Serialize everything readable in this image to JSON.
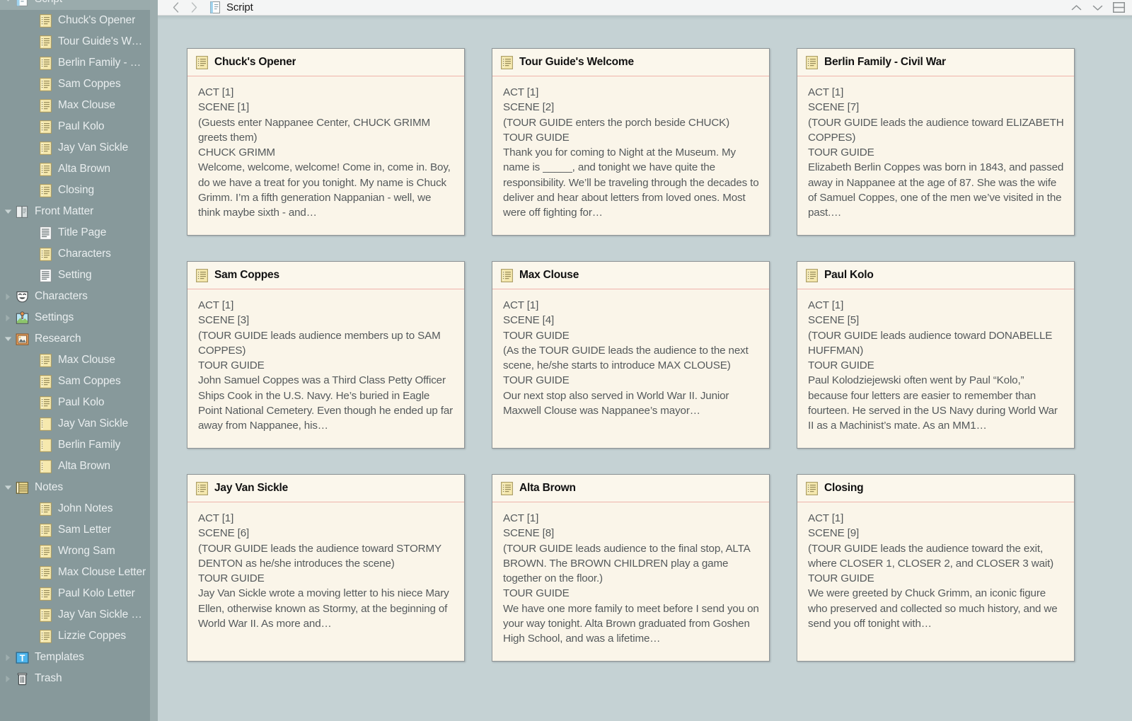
{
  "header": {
    "back_label": "‹",
    "forward_label": "›",
    "doc_icon": "script-document-icon",
    "title": "Script",
    "up_label": "chevron-up-icon",
    "down_label": "chevron-down-icon",
    "split_label": "split-view-icon"
  },
  "binder": {
    "items": [
      {
        "label": "Script",
        "icon": "script-document-icon",
        "level": 0,
        "twisty": "down",
        "selected": true,
        "partial": true
      },
      {
        "label": "Chuck's Opener",
        "icon": "script-page-icon",
        "level": 1,
        "twisty": "none",
        "selected": false
      },
      {
        "label": "Tour Guide's Welc…",
        "icon": "script-page-icon",
        "level": 1,
        "twisty": "none",
        "selected": false
      },
      {
        "label": "Berlin Family - Civ…",
        "icon": "script-page-icon",
        "level": 1,
        "twisty": "none",
        "selected": false
      },
      {
        "label": "Sam Coppes",
        "icon": "script-page-icon",
        "level": 1,
        "twisty": "none",
        "selected": false
      },
      {
        "label": "Max Clouse",
        "icon": "script-page-icon",
        "level": 1,
        "twisty": "none",
        "selected": false
      },
      {
        "label": "Paul Kolo",
        "icon": "script-page-icon",
        "level": 1,
        "twisty": "none",
        "selected": false
      },
      {
        "label": "Jay Van Sickle",
        "icon": "script-page-icon",
        "level": 1,
        "twisty": "none",
        "selected": false
      },
      {
        "label": "Alta Brown",
        "icon": "script-page-icon",
        "level": 1,
        "twisty": "none",
        "selected": false
      },
      {
        "label": "Closing",
        "icon": "script-page-icon",
        "level": 1,
        "twisty": "none",
        "selected": false
      },
      {
        "label": "Front Matter",
        "icon": "front-matter-folder-icon",
        "level": 0,
        "twisty": "down",
        "selected": false
      },
      {
        "label": "Title Page",
        "icon": "text-page-icon",
        "level": 1,
        "twisty": "none",
        "selected": false
      },
      {
        "label": "Characters",
        "icon": "script-page-icon",
        "level": 1,
        "twisty": "none",
        "selected": false
      },
      {
        "label": "Setting",
        "icon": "text-page-icon",
        "level": 1,
        "twisty": "none",
        "selected": false
      },
      {
        "label": "Characters",
        "icon": "theatre-mask-icon",
        "level": 0,
        "twisty": "right",
        "selected": false
      },
      {
        "label": "Settings",
        "icon": "settings-place-icon",
        "level": 0,
        "twisty": "right",
        "selected": false
      },
      {
        "label": "Research",
        "icon": "research-folder-icon",
        "level": 0,
        "twisty": "down",
        "selected": false
      },
      {
        "label": "Max Clouse",
        "icon": "script-page-icon",
        "level": 1,
        "twisty": "none",
        "selected": false
      },
      {
        "label": "Sam Coppes",
        "icon": "script-page-icon",
        "level": 1,
        "twisty": "none",
        "selected": false
      },
      {
        "label": "Paul Kolo",
        "icon": "script-page-icon",
        "level": 1,
        "twisty": "none",
        "selected": false
      },
      {
        "label": "Jay Van Sickle",
        "icon": "blank-page-icon",
        "level": 1,
        "twisty": "none",
        "selected": false
      },
      {
        "label": "Berlin Family",
        "icon": "blank-page-icon",
        "level": 1,
        "twisty": "none",
        "selected": false
      },
      {
        "label": "Alta Brown",
        "icon": "blank-page-icon",
        "level": 1,
        "twisty": "none",
        "selected": false
      },
      {
        "label": "Notes",
        "icon": "notes-folder-icon",
        "level": 0,
        "twisty": "down",
        "selected": false
      },
      {
        "label": "John Notes",
        "icon": "script-page-icon",
        "level": 1,
        "twisty": "none",
        "selected": false
      },
      {
        "label": "Sam Letter",
        "icon": "script-page-icon",
        "level": 1,
        "twisty": "none",
        "selected": false
      },
      {
        "label": "Wrong Sam",
        "icon": "script-page-icon",
        "level": 1,
        "twisty": "none",
        "selected": false
      },
      {
        "label": "Max Clouse Letter",
        "icon": "script-page-icon",
        "level": 1,
        "twisty": "none",
        "selected": false
      },
      {
        "label": "Paul Kolo Letter",
        "icon": "script-page-icon",
        "level": 1,
        "twisty": "none",
        "selected": false
      },
      {
        "label": "Jay Van Sickle Let…",
        "icon": "script-page-icon",
        "level": 1,
        "twisty": "none",
        "selected": false
      },
      {
        "label": "Lizzie Coppes",
        "icon": "script-page-icon",
        "level": 1,
        "twisty": "none",
        "selected": false
      },
      {
        "label": "Templates",
        "icon": "templates-folder-icon",
        "level": 0,
        "twisty": "right",
        "selected": false
      },
      {
        "label": "Trash",
        "icon": "trash-icon",
        "level": 0,
        "twisty": "right",
        "selected": false
      }
    ]
  },
  "corkboard": {
    "cards": [
      {
        "icon": "script-page-icon",
        "title": "Chuck's Opener",
        "synopsis": "ACT [1]\nSCENE [1]\n(Guests enter Nappanee Center, CHUCK GRIMM greets them)\nCHUCK GRIMM\nWelcome, welcome, welcome! Come in, come in. Boy, do we have a treat for you tonight. My name is Chuck Grimm. I’m a fifth generation Nappanian - well, we think maybe sixth - and…"
      },
      {
        "icon": "script-page-icon",
        "title": "Tour Guide's Welcome",
        "synopsis": "ACT [1]\nSCENE [2]\n(TOUR GUIDE enters the porch beside CHUCK)\nTOUR GUIDE\nThank you for coming to Night at the Museum. My name is _____, and tonight we have quite the responsibility. We’ll be traveling through the decades to deliver and hear about letters from loved ones. Most were off fighting for…"
      },
      {
        "icon": "script-page-icon",
        "title": "Berlin Family - Civil War",
        "synopsis": "ACT [1]\nSCENE [7]\n(TOUR GUIDE leads the audience toward ELIZABETH COPPES)\nTOUR GUIDE\nElizabeth Berlin Coppes was born in 1843, and passed away in Nappanee at the age of 87. She was the wife of Samuel Coppes, one of the men we’ve visited in the past.…"
      },
      {
        "icon": "script-page-icon",
        "title": "Sam Coppes",
        "synopsis": "ACT [1]\nSCENE [3]\n(TOUR GUIDE leads audience members up to SAM COPPES)\nTOUR GUIDE\nJohn Samuel Coppes was a Third Class Petty Officer Ships Cook in the U.S. Navy. He’s buried in Eagle Point National Cemetery. Even though he ended up far away from Nappanee, his…"
      },
      {
        "icon": "script-page-icon",
        "title": "Max Clouse",
        "synopsis": "ACT [1]\nSCENE [4]\nTOUR GUIDE\n(As the TOUR GUIDE leads the audience to the next scene, he/she starts to introduce MAX CLOUSE)\nTOUR GUIDE\nOur next stop also served in World War II. Junior Maxwell Clouse was Nappanee’s mayor…"
      },
      {
        "icon": "script-page-icon",
        "title": "Paul Kolo",
        "synopsis": "ACT [1]\nSCENE [5]\n(TOUR GUIDE leads audience toward DONABELLE HUFFMAN)\nTOUR GUIDE\nPaul Kolodziejewski often went by Paul “Kolo,” because four letters are easier to remember than fourteen. He served in the US Navy during World War II as a Machinist’s mate. As an MM1…"
      },
      {
        "icon": "script-page-icon",
        "title": "Jay Van Sickle",
        "synopsis": "ACT [1]\nSCENE [6]\n(TOUR GUIDE leads the audience toward STORMY DENTON as he/she introduces the scene)\nTOUR GUIDE\nJay Van Sickle wrote a moving letter to his niece Mary Ellen, otherwise known as Stormy, at the beginning of World War II. As more and…"
      },
      {
        "icon": "script-page-icon",
        "title": "Alta Brown",
        "synopsis": "ACT [1]\nSCENE [8]\n(TOUR GUIDE leads audience to the final stop, ALTA BROWN. The BROWN CHILDREN play a game together on the floor.)\nTOUR GUIDE\nWe have one more family to meet before I send you on your way tonight. Alta Brown graduated from Goshen High School, and was a lifetime…"
      },
      {
        "icon": "script-page-icon",
        "title": "Closing",
        "synopsis": "ACT [1]\nSCENE [9]\n(TOUR GUIDE leads the audience toward the exit, where CLOSER 1, CLOSER 2, and CLOSER 3 wait)\nTOUR GUIDE\nWe were greeted by Chuck Grimm, an iconic figure who preserved and collected so much history, and we send you off tonight with…"
      }
    ]
  },
  "colors": {
    "binder_bg": "#87999b",
    "binder_selected": "#9aabac",
    "corkboard_bg": "#c5d2d4",
    "card_bg": "#faf5e9",
    "card_divider": "#efb3ab",
    "header_bg": "#f4f5f5"
  }
}
